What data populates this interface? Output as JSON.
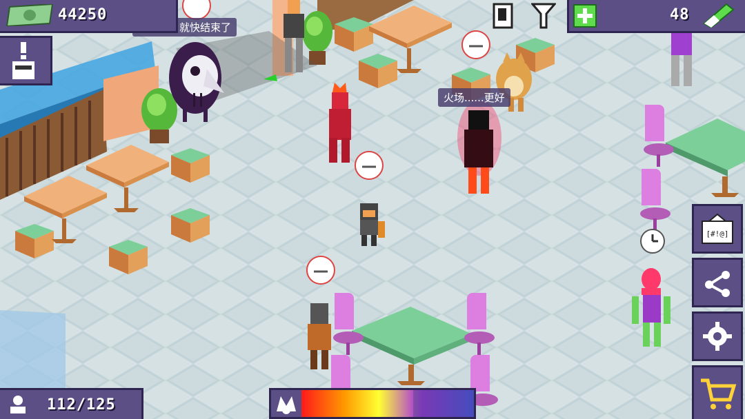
{
  "hud": {
    "money": "44250",
    "energy": "48",
    "population": "112/125",
    "alert_icon": "warning-character-icon",
    "status_icons": [
      "phone-icon",
      "signal-icon"
    ]
  },
  "speech": {
    "top_bubble": "冷静点，就快结束了",
    "mid_bubble": "火场......更好"
  },
  "side_buttons": [
    "gift-code-button",
    "share-button",
    "settings-button",
    "shop-cart-button"
  ],
  "gift_label": "[#!@]",
  "colors": {
    "hud_bg": "#5b4f86",
    "hud_border": "#2e2550",
    "floor_light": "#d9e4e7",
    "floor_dark": "#b9cbd0",
    "table_wood": "#e2a05a",
    "table_green": "#7ccf99",
    "chair_pink": "#dd7fe0",
    "mood_gradient": [
      "#ff0000",
      "#ffcc00",
      "#ffff00",
      "#7f00ff",
      "#2244ff"
    ]
  }
}
